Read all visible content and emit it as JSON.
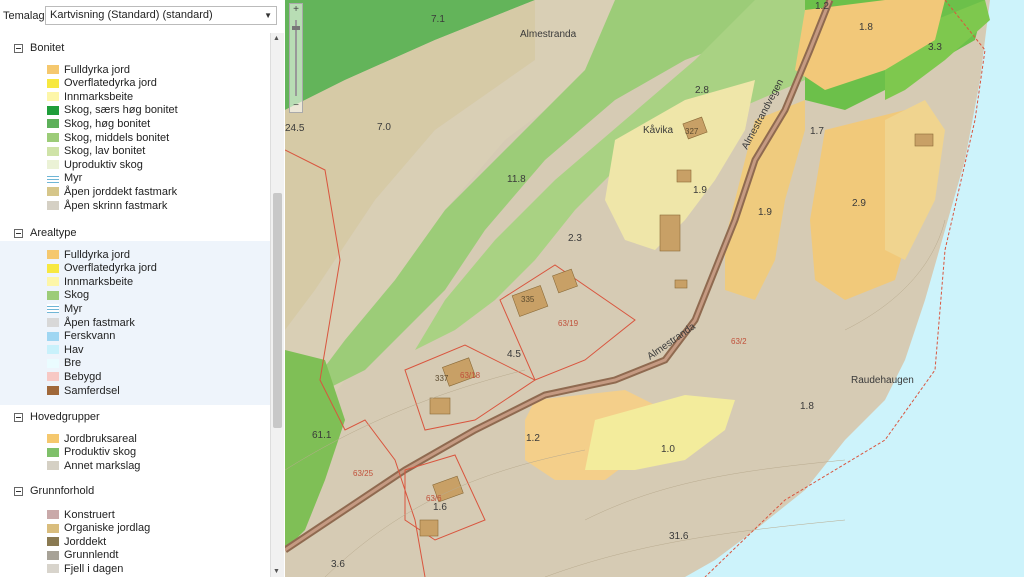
{
  "toolbar": {
    "temalag_label": "Temalag:",
    "temalag_value": "Kartvisning (Standard) (standard)"
  },
  "legend": {
    "groups": [
      {
        "title": "Bonitet",
        "items": [
          {
            "label": "Fulldyrka jord",
            "color": "#f5c86e"
          },
          {
            "label": "Overflatedyrka jord",
            "color": "#f7e840"
          },
          {
            "label": "Innmarksbeite",
            "color": "#fdf6a8"
          },
          {
            "label": "Skog, særs høg bonitet",
            "color": "#1f9e3a"
          },
          {
            "label": "Skog, høg bonitet",
            "color": "#5db05a"
          },
          {
            "label": "Skog, middels bonitet",
            "color": "#9ccc78"
          },
          {
            "label": "Skog, lav bonitet",
            "color": "#cfe3a8"
          },
          {
            "label": "Uproduktiv skog",
            "color": "#ebf2d6"
          },
          {
            "label": "Myr",
            "color": "lines"
          },
          {
            "label": "Åpen jorddekt fastmark",
            "color": "#d6c68a"
          },
          {
            "label": "Åpen skrinn fastmark",
            "color": "#d5d0c4"
          }
        ]
      },
      {
        "title": "Arealtype",
        "items": [
          {
            "label": "Fulldyrka jord",
            "color": "#f5c86e"
          },
          {
            "label": "Overflatedyrka jord",
            "color": "#f7e840"
          },
          {
            "label": "Innmarksbeite",
            "color": "#fdf6a8"
          },
          {
            "label": "Skog",
            "color": "#9ccc78"
          },
          {
            "label": "Myr",
            "color": "lines"
          },
          {
            "label": "Åpen fastmark",
            "color": "#d8d8d8"
          },
          {
            "label": "Ferskvann",
            "color": "#9fd6f2"
          },
          {
            "label": "Hav",
            "color": "#c9f1fb"
          },
          {
            "label": "Bre",
            "color": "#eafcff"
          },
          {
            "label": "Bebygd",
            "color": "#f7c8c4"
          },
          {
            "label": "Samferdsel",
            "color": "#a0683a"
          }
        ]
      },
      {
        "title": "Hovedgrupper",
        "items": [
          {
            "label": "Jordbruksareal",
            "color": "#f5c86e"
          },
          {
            "label": "Produktiv skog",
            "color": "#7fc06a"
          },
          {
            "label": "Annet markslag",
            "color": "#d5d0c4"
          }
        ]
      },
      {
        "title": "Grunnforhold",
        "items": [
          {
            "label": "Konstruert",
            "color": "#c9a9a9"
          },
          {
            "label": "Organiske jordlag",
            "color": "#d9bd7d"
          },
          {
            "label": "Jorddekt",
            "color": "#8a7a52"
          },
          {
            "label": "Grunnlendt",
            "color": "#a7a297"
          },
          {
            "label": "Fjell i dagen",
            "color": "#d8d4cc"
          }
        ]
      }
    ]
  },
  "map": {
    "zoom_in": "+",
    "zoom_out": "−",
    "place_names": [
      "Almestranda",
      "Kåvika",
      "Raudehaugen"
    ],
    "road_labels": [
      "Almestrandvegen",
      "Almestranda"
    ],
    "area_values": [
      "7.1",
      "1.2",
      "1.8",
      "3.3",
      "2.8",
      "24.5",
      "7.0",
      "1.7",
      "11.8",
      "1.9",
      "1.9",
      "2.9",
      "2.3",
      "4.5",
      "1.8",
      "61.1",
      "1.2",
      "1.0",
      "1.6",
      "31.6",
      "3.6"
    ],
    "plot_ids": [
      "63/19",
      "63/18",
      "63/2",
      "63/25",
      "63/6"
    ],
    "house_numbers": [
      "327",
      "335",
      "337"
    ]
  }
}
